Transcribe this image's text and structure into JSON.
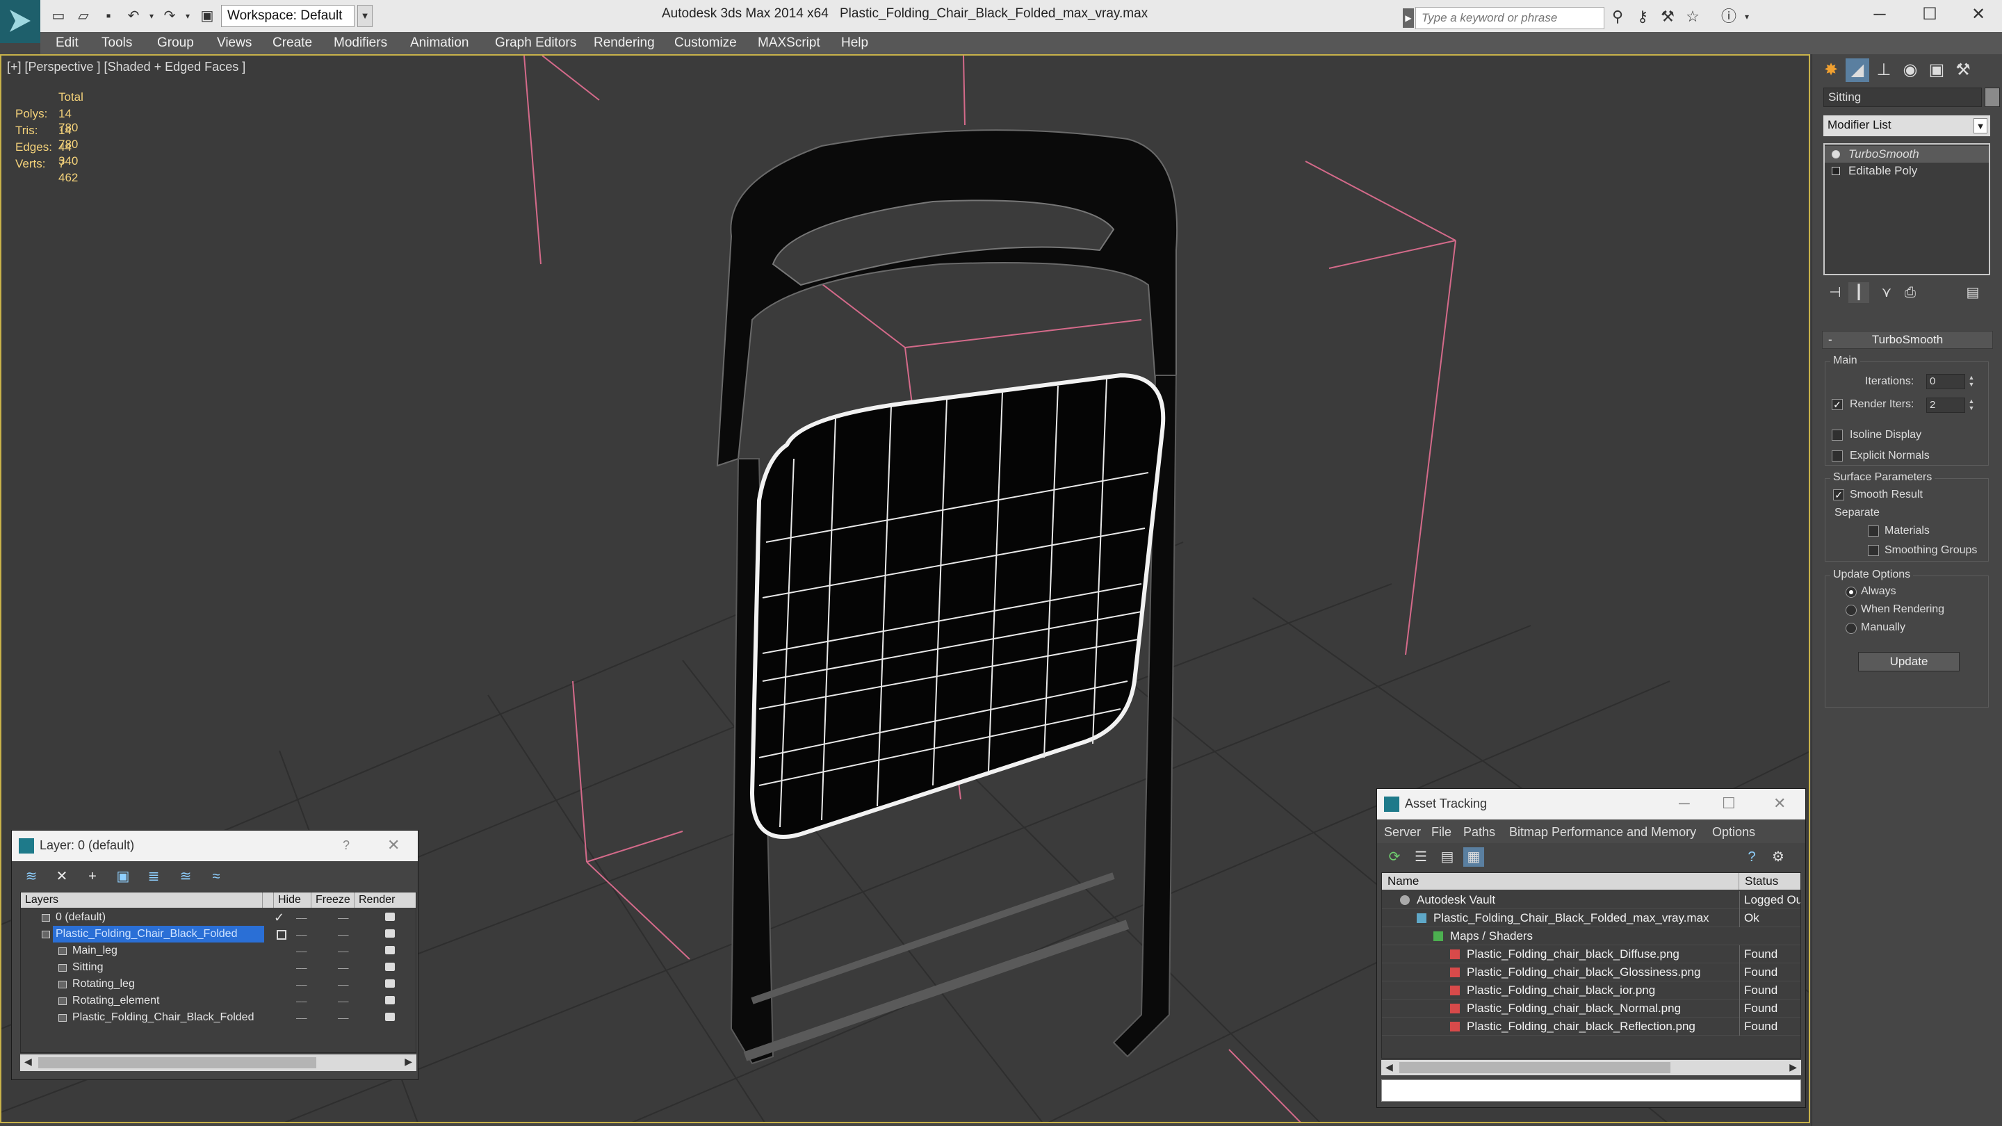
{
  "titlebar": {
    "workspace": "Workspace: Default",
    "app_title": "Autodesk 3ds Max  2014 x64",
    "file_title": "Plastic_Folding_Chair_Black_Folded_max_vray.max",
    "search_placeholder": "Type a keyword or phrase",
    "window_controls": [
      "minimize-icon",
      "maximize-icon",
      "close-icon"
    ]
  },
  "menubar": {
    "items": [
      "Edit",
      "Tools",
      "Group",
      "Views",
      "Create",
      "Modifiers",
      "Animation",
      "Graph Editors",
      "Rendering",
      "Customize",
      "MAXScript",
      "Help"
    ]
  },
  "viewport": {
    "label": "[+] [Perspective ] [Shaded + Edged Faces ]",
    "stats": {
      "header": "Total",
      "rows": [
        {
          "label": "Polys:",
          "value": "14 780"
        },
        {
          "label": "Tris:",
          "value": "14 780"
        },
        {
          "label": "Edges:",
          "value": "44 340"
        },
        {
          "label": "Verts:",
          "value": "7 462"
        }
      ]
    }
  },
  "command_panel": {
    "object_name": "Sitting",
    "modifier_list": "Modifier List",
    "stack": [
      "TurboSmooth",
      "Editable Poly"
    ],
    "rollout_title": "TurboSmooth",
    "main_label": "Main",
    "iterations_label": "Iterations:",
    "iterations_value": "0",
    "render_iters_label": "Render Iters:",
    "render_iters_value": "2",
    "render_iters_checked": true,
    "isoline_label": "Isoline Display",
    "explicit_normals_label": "Explicit Normals",
    "surface_params_label": "Surface Parameters",
    "smooth_result_label": "Smooth Result",
    "smooth_result_checked": true,
    "separate_label": "Separate",
    "materials_label": "Materials",
    "smoothing_groups_label": "Smoothing Groups",
    "update_options_label": "Update Options",
    "update_always": "Always",
    "update_when_rendering": "When Rendering",
    "update_manually": "Manually",
    "update_button": "Update"
  },
  "layer_dialog": {
    "title": "Layer: 0 (default)",
    "help": "?",
    "columns": [
      "Layers",
      "Hide",
      "Freeze",
      "Render"
    ],
    "rows": [
      {
        "name": "0 (default)",
        "indent": 1
      },
      {
        "name": "Plastic_Folding_Chair_Black_Folded",
        "indent": 1
      },
      {
        "name": "Main_leg",
        "indent": 2
      },
      {
        "name": "Sitting",
        "indent": 2
      },
      {
        "name": "Rotating_leg",
        "indent": 2
      },
      {
        "name": "Rotating_element",
        "indent": 2
      },
      {
        "name": "Plastic_Folding_Chair_Black_Folded",
        "indent": 2
      }
    ]
  },
  "asset_dialog": {
    "title": "Asset Tracking",
    "menu": [
      "Server",
      "File",
      "Paths",
      "Bitmap Performance and Memory",
      "Options"
    ],
    "columns": [
      "Name",
      "Status"
    ],
    "rows": [
      {
        "name": "Autodesk Vault",
        "status": "Logged Ou"
      },
      {
        "name": "Plastic_Folding_Chair_Black_Folded_max_vray.max",
        "status": "Ok"
      },
      {
        "name": "Maps / Shaders",
        "status": ""
      },
      {
        "name": "Plastic_Folding_chair_black_Diffuse.png",
        "status": "Found"
      },
      {
        "name": "Plastic_Folding_chair_black_Glossiness.png",
        "status": "Found"
      },
      {
        "name": "Plastic_Folding_chair_black_ior.png",
        "status": "Found"
      },
      {
        "name": "Plastic_Folding_chair_black_Normal.png",
        "status": "Found"
      },
      {
        "name": "Plastic_Folding_chair_black_Reflection.png",
        "status": "Found"
      }
    ]
  },
  "colors": {
    "viewport_bg": "#3b3b3b",
    "active_border": "#c8b24a",
    "stats_text": "#f4d27a",
    "selection": "#2a6fd6",
    "brand": "#1e5f6b"
  }
}
